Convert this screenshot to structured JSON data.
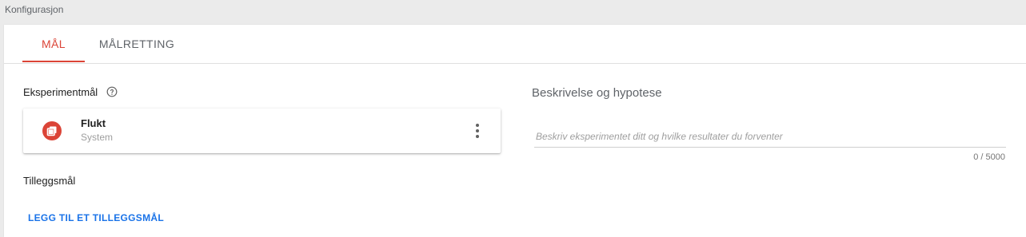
{
  "section_header": "Konfigurasjon",
  "tabs": [
    {
      "label": "MÅL",
      "active": true
    },
    {
      "label": "MÅLRETTING",
      "active": false
    }
  ],
  "goals": {
    "title": "Eksperimentmål",
    "help_icon": "help-circle-icon",
    "primary": {
      "name": "Flukt",
      "source": "System",
      "icon": "bounce-icon",
      "icon_color": "#db4437",
      "menu_icon": "more-vert-icon"
    },
    "additional_title": "Tilleggsmål",
    "add_label": "LEGG TIL ET TILLEGGSMÅL"
  },
  "description": {
    "title": "Beskrivelse og hypotese",
    "placeholder": "Beskriv eksperimentet ditt og hvilke resultater du forventer",
    "value": "",
    "counter": "0 / 5000"
  },
  "colors": {
    "accent": "#db4437",
    "link": "#1a73e8"
  }
}
